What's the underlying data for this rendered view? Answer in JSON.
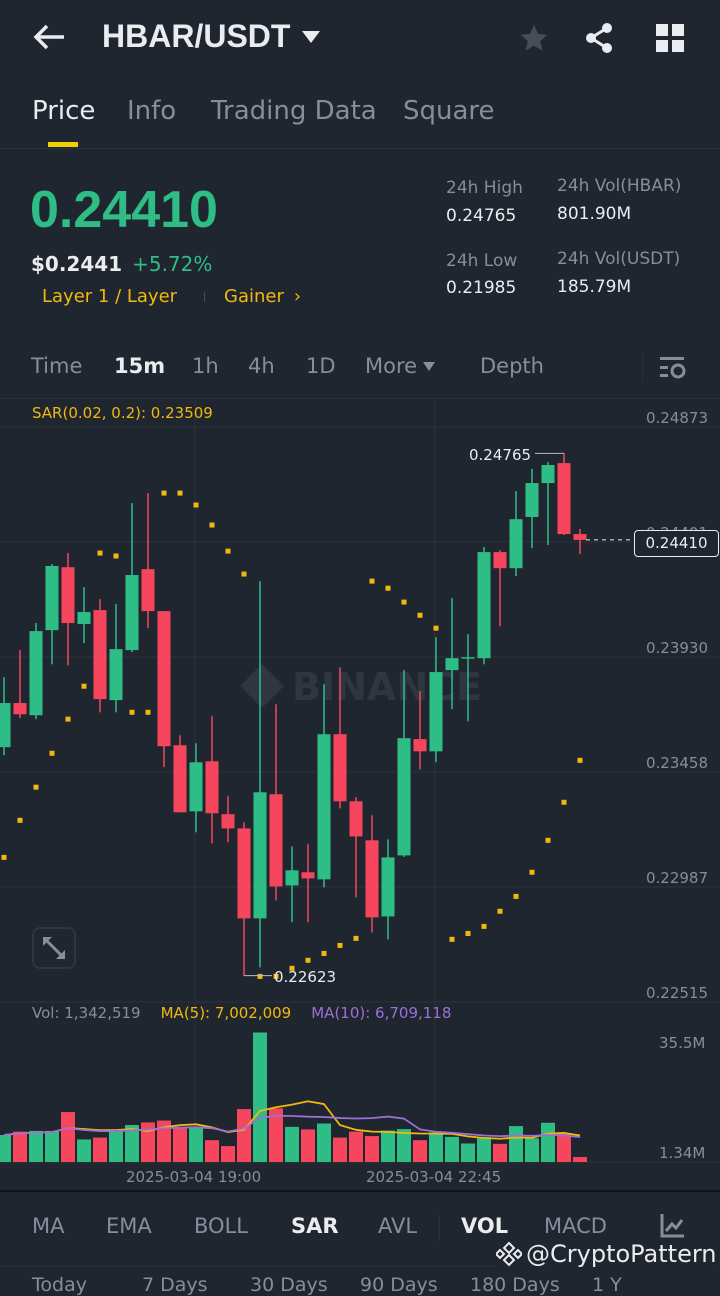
{
  "header": {
    "pair": "HBAR/USDT"
  },
  "tabs": [
    {
      "label": "Price"
    },
    {
      "label": "Info"
    },
    {
      "label": "Trading Data"
    },
    {
      "label": "Square"
    }
  ],
  "ticker": {
    "last_price": "0.24410",
    "usd_price": "$0.2441",
    "change": "+5.72%",
    "tag1": "Layer 1 / Layer",
    "tag2": "Gainer",
    "high_label": "24h High",
    "high": "0.24765",
    "low_label": "24h Low",
    "low": "0.21985",
    "vol_base_label": "24h Vol(HBAR)",
    "vol_base": "801.90M",
    "vol_quote_label": "24h Vol(USDT)",
    "vol_quote": "185.79M"
  },
  "intervals": [
    {
      "label": "Time"
    },
    {
      "label": "15m"
    },
    {
      "label": "1h"
    },
    {
      "label": "4h"
    },
    {
      "label": "1D"
    },
    {
      "label": "More"
    },
    {
      "label": "Depth"
    }
  ],
  "colors": {
    "up": "#2ebd85",
    "down": "#f6465d",
    "accent": "#f0b90b",
    "ma10": "#9c6fd6"
  },
  "chart_data": {
    "type": "candlestick",
    "sar_label": "SAR(0.02, 0.2): 0.23509",
    "ylim": [
      0.22515,
      0.24873
    ],
    "price_ticks": [
      "0.24873",
      "0.24401",
      "0.23930",
      "0.23458",
      "0.22987",
      "0.22515"
    ],
    "high_marker": "0.24765",
    "low_marker": "0.22623",
    "current_price": "0.24410",
    "x_labels": [
      "2025-03-04 19:00",
      "2025-03-04 22:45"
    ],
    "candles": [
      [
        0.2356,
        0.23847,
        0.23527,
        0.23741
      ],
      [
        0.23741,
        0.23958,
        0.23679,
        0.23695
      ],
      [
        0.23691,
        0.24069,
        0.23675,
        0.24036
      ],
      [
        0.2404,
        0.24311,
        0.239,
        0.24303
      ],
      [
        0.24298,
        0.24356,
        0.23896,
        0.24069
      ],
      [
        0.24065,
        0.24216,
        0.23987,
        0.24114
      ],
      [
        0.24122,
        0.24167,
        0.23703,
        0.23757
      ],
      [
        0.23753,
        0.24147,
        0.23703,
        0.23962
      ],
      [
        0.23958,
        0.24561,
        0.2395,
        0.24266
      ],
      [
        0.2429,
        0.24602,
        0.24048,
        0.24118
      ],
      [
        0.24118,
        0.24118,
        0.23478,
        0.23564
      ],
      [
        0.23568,
        0.23609,
        0.23293,
        0.23293
      ],
      [
        0.23297,
        0.23576,
        0.23211,
        0.23498
      ],
      [
        0.23502,
        0.23687,
        0.23166,
        0.23289
      ],
      [
        0.23285,
        0.23359,
        0.2317,
        0.23227
      ],
      [
        0.23227,
        0.23252,
        0.22623,
        0.22858
      ],
      [
        0.22858,
        0.24241,
        0.22657,
        0.23375
      ],
      [
        0.23367,
        0.23736,
        0.22932,
        0.22989
      ],
      [
        0.22993,
        0.23153,
        0.22842,
        0.23055
      ],
      [
        0.23047,
        0.23162,
        0.22842,
        0.23022
      ],
      [
        0.23018,
        0.23818,
        0.22985,
        0.23613
      ],
      [
        0.23613,
        0.23888,
        0.23309,
        0.23338
      ],
      [
        0.23338,
        0.23355,
        0.22944,
        0.23194
      ],
      [
        0.23178,
        0.23281,
        0.228,
        0.22862
      ],
      [
        0.22866,
        0.23182,
        0.22772,
        0.23108
      ],
      [
        0.23116,
        0.23876,
        0.2311,
        0.23597
      ],
      [
        0.23593,
        0.2379,
        0.23469,
        0.23543
      ],
      [
        0.23543,
        0.24011,
        0.23498,
        0.23868
      ],
      [
        0.23876,
        0.24171,
        0.23716,
        0.23925
      ],
      [
        0.23925,
        0.24023,
        0.23666,
        0.23929
      ],
      [
        0.23925,
        0.24381,
        0.239,
        0.2436
      ],
      [
        0.2436,
        0.24368,
        0.24056,
        0.24294
      ],
      [
        0.24294,
        0.2461,
        0.24262,
        0.24495
      ],
      [
        0.24504,
        0.24701,
        0.24376,
        0.24643
      ],
      [
        0.24643,
        0.24729,
        0.24389,
        0.24717
      ],
      [
        0.24725,
        0.24765,
        0.2443,
        0.24434
      ],
      [
        0.24434,
        0.24455,
        0.24352,
        0.2441
      ]
    ],
    "sar": [
      0.23108,
      0.2326,
      0.23396,
      0.23535,
      0.23675,
      0.2381,
      0.24356,
      0.24344,
      0.23703,
      0.23703,
      0.24602,
      0.24602,
      0.24553,
      0.24471,
      0.24364,
      0.2427,
      0.2262,
      0.2262,
      0.22653,
      0.22686,
      0.22714,
      0.22747,
      0.22776,
      0.24241,
      0.24212,
      0.24155,
      0.24101,
      0.24048,
      0.22772,
      0.22796,
      0.22825,
      0.22887,
      0.22948,
      0.23047,
      0.23178,
      0.23334,
      0.23506
    ],
    "volume": {
      "label": "Vol: 1,342,519",
      "ma5_label": "MA(5): 7,002,009",
      "ma10_label": "MA(10): 6,709,118",
      "axis_max": "35.5M",
      "axis_min": "1.34M",
      "values_m": [
        7.3,
        8.2,
        8.4,
        8.4,
        13.5,
        6.1,
        6.6,
        8.4,
        10.0,
        10.7,
        11.2,
        9.5,
        9.5,
        5.9,
        4.3,
        14.3,
        35.0,
        14.5,
        9.5,
        8.8,
        10.4,
        6.6,
        8.2,
        7.0,
        8.5,
        8.9,
        5.9,
        8.0,
        6.8,
        5.0,
        6.7,
        4.9,
        9.7,
        6.4,
        10.6,
        7.7,
        1.34
      ]
    }
  },
  "indicators": [
    {
      "label": "MA"
    },
    {
      "label": "EMA"
    },
    {
      "label": "BOLL"
    },
    {
      "label": "SAR"
    },
    {
      "label": "AVL"
    },
    {
      "label": "VOL"
    },
    {
      "label": "MACD"
    }
  ],
  "watermark": "@CryptoPattern",
  "periods": [
    {
      "label": "Today"
    },
    {
      "label": "7 Days"
    },
    {
      "label": "30 Days"
    },
    {
      "label": "90 Days"
    },
    {
      "label": "180 Days"
    },
    {
      "label": "1 Y"
    }
  ]
}
